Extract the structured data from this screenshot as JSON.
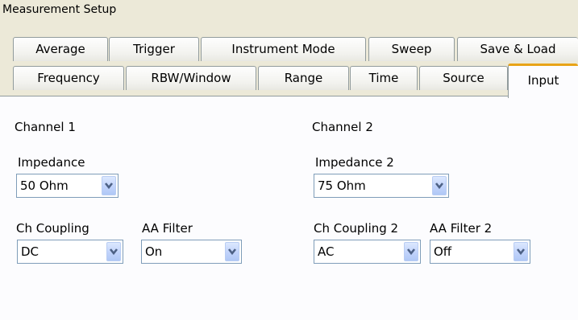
{
  "window_title": "Measurement Setup",
  "tabs_row1": [
    "Average",
    "Trigger",
    "Instrument Mode",
    "Sweep",
    "Save & Load"
  ],
  "tabs_row2": [
    "Frequency",
    "RBW/Window",
    "Range",
    "Time",
    "Source",
    "Input"
  ],
  "active_tab": "Input",
  "channel1": {
    "heading": "Channel 1",
    "impedance_label": "Impedance",
    "impedance_value": "50 Ohm",
    "coupling_label": "Ch Coupling",
    "coupling_value": "DC",
    "filter_label": "AA Filter",
    "filter_value": "On"
  },
  "channel2": {
    "heading": "Channel 2",
    "impedance_label": "Impedance 2",
    "impedance_value": "75 Ohm",
    "coupling_label": "Ch Coupling 2",
    "coupling_value": "AC",
    "filter_label": "AA Filter 2",
    "filter_value": "Off"
  },
  "colors": {
    "accent": "#e8a317",
    "dropdown_arrow": "#4d6185",
    "field_border": "#7f9db9",
    "panel_bg": "#fcfcfe",
    "window_bg": "#ece9d8"
  },
  "icons": {
    "dropdown": "chevron-down-icon"
  }
}
